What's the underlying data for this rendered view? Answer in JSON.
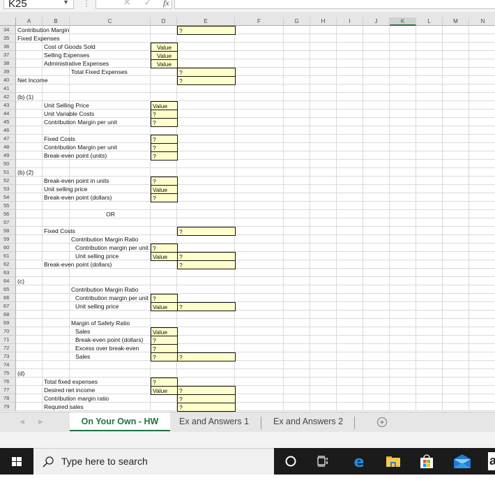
{
  "formula_bar": {
    "name_box": "K25",
    "fx_label": "fx",
    "formula": ""
  },
  "columns": [
    "A",
    "B",
    "C",
    "D",
    "E",
    "F",
    "G",
    "H",
    "I",
    "J",
    "K",
    "L",
    "M",
    "N"
  ],
  "selected_column": "K",
  "rows": [
    "34",
    "35",
    "36",
    "37",
    "38",
    "39",
    "40",
    "41",
    "42",
    "43",
    "44",
    "45",
    "46",
    "47",
    "48",
    "49",
    "50",
    "51",
    "52",
    "53",
    "54",
    "55",
    "56",
    "57",
    "58",
    "59",
    "60",
    "61",
    "62",
    "63",
    "64",
    "65",
    "66",
    "67",
    "68",
    "69",
    "70",
    "71",
    "72",
    "73",
    "74",
    "75",
    "76",
    "77",
    "78",
    "79"
  ],
  "cells": {
    "A34": "Contribution Margin",
    "E34": "?",
    "A35": "Fixed Expenses",
    "B36": "Cost of Goods Sold",
    "D36": "Value",
    "B37": "Selling Expenses",
    "D37": "Value",
    "B38": "Administrative Expenses",
    "D38": "Value",
    "C39": "Total Fixed Expenses",
    "E39": "?",
    "A40": "Net Income",
    "E40": "?",
    "A42": "(b) (1)",
    "B43": "Unit Selling Price",
    "D43": "Value",
    "B44": "Unit Variable Costs",
    "D44": "?",
    "B45": "Contribution Margin per unit",
    "D45": "?",
    "B47": "Fixed Costs",
    "D47": "?",
    "B48": "Contribution Margin per unit",
    "D48": "?",
    "B49": "Break-even point (units)",
    "D49": "?",
    "A51": "(b) (2)",
    "B52": "Break-even point in units",
    "D52": "?",
    "B53": "Unit selling price",
    "D53": "Value",
    "B54": "Break-even point (dollars)",
    "D54": "?",
    "C56": "OR",
    "B58": "Fixed Costs",
    "E58": "?",
    "C59": "Contribution Margin Ratio",
    "C60": "Contribution margin per unit",
    "D60": "?",
    "C61": "Unit selling price",
    "D61": "Value",
    "E61": "?",
    "B62": "Break-even point (dollars)",
    "E62": "?",
    "A64": "(c)",
    "C65": "Contribution Margin Ratio",
    "C66": "Contribution margin per unit",
    "D66": "?",
    "C67": "Unit selling price",
    "D67": "Value",
    "E67": "?",
    "C69": "Margin of Safety Ratio",
    "C70": "Sales",
    "D70": "Value",
    "C71": "Break-even point (dollars)",
    "D71": "?",
    "C72": "Excess over break-even",
    "D72": "?",
    "C73": "Sales",
    "D73": "?",
    "E73": "?",
    "A75": "(d)",
    "B76": "Total fixed expenses",
    "D76": "?",
    "B77": "Desired net income",
    "D77": "Value",
    "E77": "?",
    "B78": "Contribution margin ratio",
    "E78": "?",
    "B79": "Required sales",
    "E79": "?"
  },
  "sheet_tabs": [
    {
      "label": "On Your Own - HW",
      "active": true
    },
    {
      "label": "Ex and Answers 1",
      "active": false
    },
    {
      "label": "Ex and Answers 2",
      "active": false
    }
  ],
  "add_sheet_icon": "plus-circle-icon",
  "taskbar": {
    "search_placeholder": "Type here to search",
    "icons": [
      "windows-start-icon",
      "search-icon",
      "cortana-icon",
      "task-view-icon",
      "edge-icon",
      "file-explorer-icon",
      "store-icon",
      "mail-icon",
      "amazon-icon"
    ]
  },
  "colors": {
    "input_cell_fill": "#ffffcc",
    "excel_green": "#217346"
  }
}
